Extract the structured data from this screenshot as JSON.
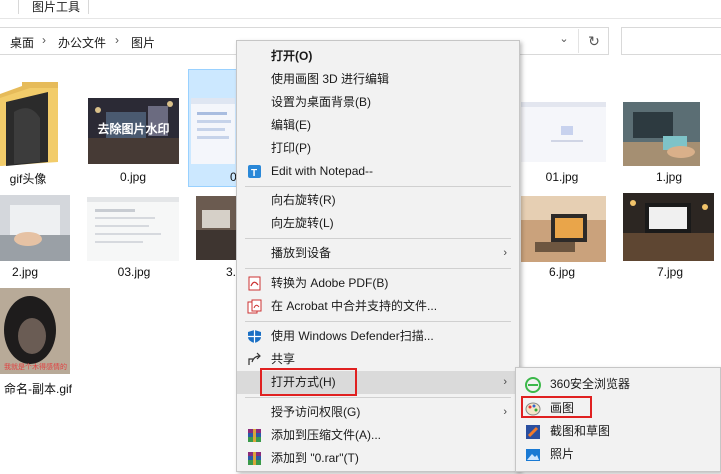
{
  "ribbon": {
    "tab_label": "图片工具"
  },
  "address": {
    "crumbs": [
      "桌面",
      "办公文件",
      "图片"
    ],
    "chevron": "›",
    "dropdown": "⌄",
    "refresh": "↻"
  },
  "files": [
    {
      "name": "gif头像",
      "kind": "folder"
    },
    {
      "name": "0.jpg",
      "overlay": "去除图片水印"
    },
    {
      "name": "0.",
      "kind": "selected"
    },
    {
      "name": "01.jpg"
    },
    {
      "name": "1.jpg"
    },
    {
      "name": "2.jpg"
    },
    {
      "name": "03.jpg"
    },
    {
      "name": "3."
    },
    {
      "name": "6.jpg"
    },
    {
      "name": "7.jpg"
    },
    {
      "name": "命名-副本.gif",
      "overlay": "我就是个木得感情的"
    }
  ],
  "context_menu": {
    "items": [
      {
        "label": "打开(O)",
        "bold": true
      },
      {
        "label": "使用画图 3D 进行编辑"
      },
      {
        "label": "设置为桌面背景(B)"
      },
      {
        "label": "编辑(E)"
      },
      {
        "label": "打印(P)"
      },
      {
        "label": "Edit with Notepad--",
        "icon": "notepad-icon"
      },
      {
        "label": "向右旋转(R)"
      },
      {
        "label": "向左旋转(L)"
      },
      {
        "label": "播放到设备",
        "submenu": true
      },
      {
        "label": "转换为 Adobe PDF(B)",
        "icon": "pdf-icon"
      },
      {
        "label": "在 Acrobat 中合并支持的文件...",
        "icon": "acrobat-icon"
      },
      {
        "label": "使用 Windows Defender扫描...",
        "icon": "shield-icon"
      },
      {
        "label": "共享",
        "icon": "share-icon"
      },
      {
        "label": "打开方式(H)",
        "submenu": true,
        "highlighted": true
      },
      {
        "label": "授予访问权限(G)",
        "submenu": true
      },
      {
        "label": "添加到压缩文件(A)...",
        "icon": "winrar-icon"
      },
      {
        "label": "添加到 \"0.rar\"(T)",
        "icon": "winrar-icon"
      }
    ],
    "arrow": "›"
  },
  "open_with_submenu": {
    "items": [
      {
        "label": "360安全浏览器",
        "icon": "browser-360-icon"
      },
      {
        "label": "画图",
        "icon": "paint-icon",
        "highlighted": true
      },
      {
        "label": "截图和草图",
        "icon": "snip-sketch-icon"
      },
      {
        "label": "照片",
        "icon": "photos-icon"
      }
    ]
  },
  "colors": {
    "highlight_box": "#e02020",
    "selection": "#cce8ff",
    "menu_bg": "#f2f2f2"
  }
}
